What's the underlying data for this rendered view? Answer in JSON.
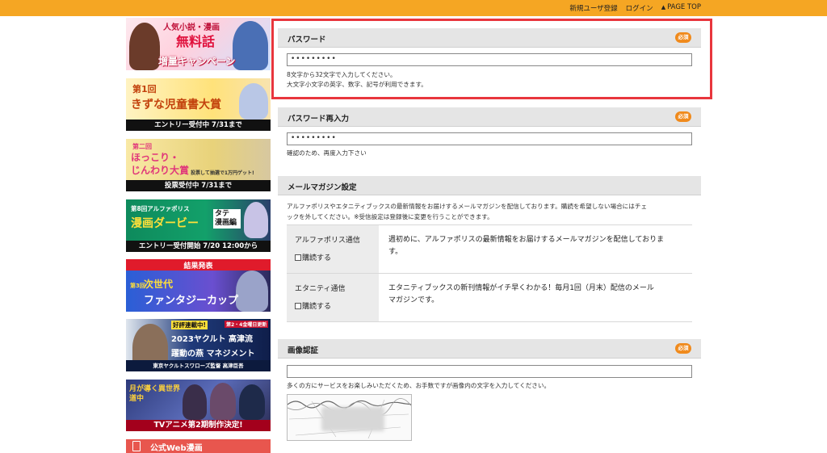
{
  "topnav": {
    "signup": "新規ユーザ登録",
    "login": "ログイン",
    "page_top": "PAGE TOP"
  },
  "banners": [
    {
      "line1": "人気小説・漫画",
      "line2": "無料話",
      "line3": "増量キャンペーン"
    },
    {
      "line1": "第1回",
      "line2": "きずな児童書大賞",
      "strip": "エントリー受付中 7/31まで"
    },
    {
      "line1": "第二回",
      "line2": "ほっこり・",
      "line3": "じんわり大賞",
      "note": "投票して抽選で1万円ゲット!",
      "strip": "投票受付中 7/31まで"
    },
    {
      "line1": "第8回アルファポリス",
      "line2": "漫画ダービー",
      "tag": "タテ 漫画編",
      "strip": "エントリー受付開始 7/20 12:00から"
    },
    {
      "head": "結果発表",
      "line1": "第3回",
      "line2": "次世代",
      "line3": "ファンタジーカップ"
    },
    {
      "line1": "好評連載中!",
      "tag": "第2・4金曜日更新",
      "line2": "2023ヤクルト 高津流",
      "line3": "躍動の燕 マネジメント",
      "strip": "東京ヤクルトスワローズ監督 高津臣吾"
    },
    {
      "line1": "月が導く異世界道中",
      "strip": "TVアニメ第2期制作決定!"
    },
    {
      "line1": "公式Web漫画"
    }
  ],
  "password": {
    "label": "パスワード",
    "required": "必須",
    "value": "•••••••••",
    "hint1": "8文字から32文字で入力してください。",
    "hint2": "大文字小文字の英字、数字、記号が利用できます。"
  },
  "password_confirm": {
    "label": "パスワード再入力",
    "required": "必須",
    "value": "•••••••••",
    "hint": "確認のため、再度入力下さい"
  },
  "magazine": {
    "label": "メールマガジン設定",
    "intro1": "アルファポリスやエタニティブックスの最新情報をお届けするメールマガジンを配信しております。購読を希望しない場合にはチェ",
    "intro2": "ックを外してください。※受信設定は登録後に変更を行うことができます。",
    "items": [
      {
        "name": "アルファポリス通信",
        "check_label": "購読する",
        "desc1": "週初めに、アルファポリスの最新情報をお届けするメールマガジンを配信しておりま",
        "desc2": "す。"
      },
      {
        "name": "エタニティ通信",
        "check_label": "購読する",
        "desc1": "エタニティブックスの新刊情報がイチ早くわかる！毎月1回（月末）配信のメール",
        "desc2": "マガジンです。"
      }
    ]
  },
  "captcha": {
    "label": "画像認証",
    "required": "必須",
    "value": "",
    "hint": "多くの方にサービスをお楽しみいただくため、お手数ですが画像内の文字を入力してください。"
  },
  "colors": {
    "topbar": "#f5a623",
    "badge": "#f08a1c",
    "highlight": "#e8363d"
  }
}
